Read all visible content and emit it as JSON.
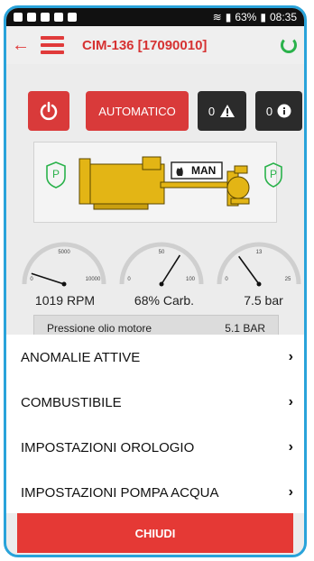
{
  "status_bar": {
    "signal_percent": "63%",
    "time": "08:35"
  },
  "header": {
    "title": "CIM-136 [17090010]"
  },
  "controls": {
    "auto_label": "AUTOMATICO",
    "alarm_count": "0",
    "info_count": "0"
  },
  "engine": {
    "mode_label": "MAN",
    "left_badge": "P",
    "right_badge": "P"
  },
  "gauges": [
    {
      "label": "1019 RPM",
      "min": "0",
      "mid": "5000",
      "max": "10000",
      "level": 0.1
    },
    {
      "label": "68% Carb.",
      "min": "0",
      "mid": "50",
      "max": "100",
      "level": 0.68
    },
    {
      "label": "7.5 bar",
      "min": "0",
      "mid": "13",
      "max": "25",
      "level": 0.3
    }
  ],
  "pressure_row": {
    "label": "Pressione olio motore",
    "value": "5.1 BAR"
  },
  "menu": {
    "items": [
      {
        "label": "ANOMALIE ATTIVE"
      },
      {
        "label": "COMBUSTIBILE"
      },
      {
        "label": "IMPOSTAZIONI OROLOGIO"
      },
      {
        "label": "IMPOSTAZIONI POMPA ACQUA"
      }
    ],
    "close_label": "CHIUDI"
  },
  "colors": {
    "accent_red": "#e53935",
    "frame_blue": "#29a3da",
    "ok_green": "#2ab24b",
    "engine_yellow": "#e3b515"
  }
}
